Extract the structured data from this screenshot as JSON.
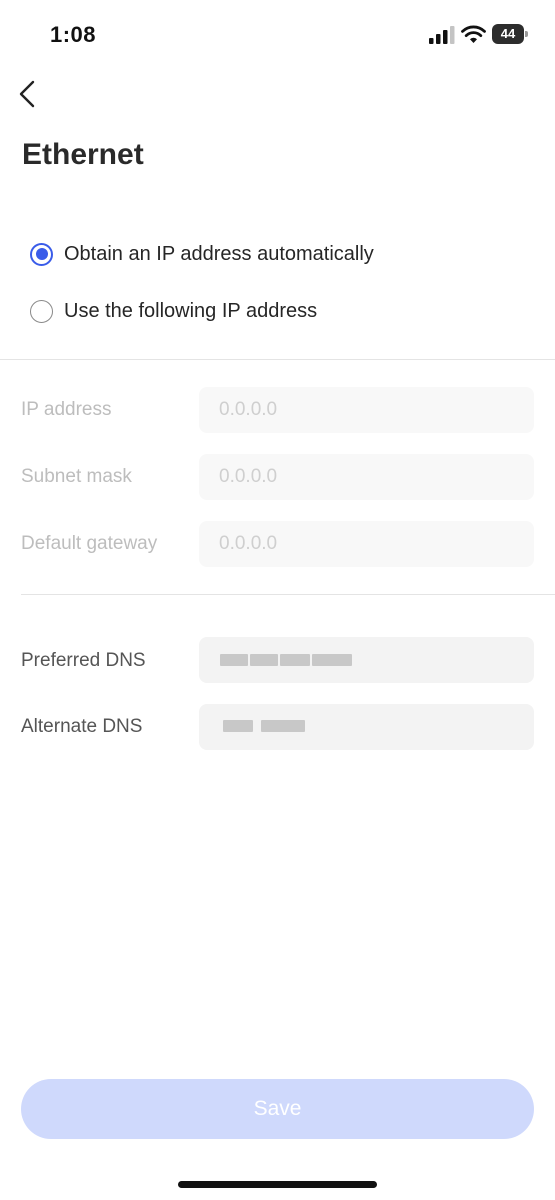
{
  "status_bar": {
    "time": "1:08",
    "battery": "44"
  },
  "header": {
    "title": "Ethernet"
  },
  "ip_mode": {
    "options": [
      {
        "label": "Obtain an IP address automatically",
        "selected": true
      },
      {
        "label": "Use the following IP address",
        "selected": false
      }
    ]
  },
  "static_fields": [
    {
      "label": "IP address",
      "placeholder": "0.0.0.0"
    },
    {
      "label": "Subnet mask",
      "placeholder": "0.0.0.0"
    },
    {
      "label": "Default gateway",
      "placeholder": "0.0.0.0"
    }
  ],
  "dns_fields": [
    {
      "label": "Preferred DNS"
    },
    {
      "label": "Alternate DNS"
    }
  ],
  "footer": {
    "save_label": "Save"
  },
  "colors": {
    "accent": "#3a5ce9",
    "save_disabled": "#cfd9fc"
  }
}
